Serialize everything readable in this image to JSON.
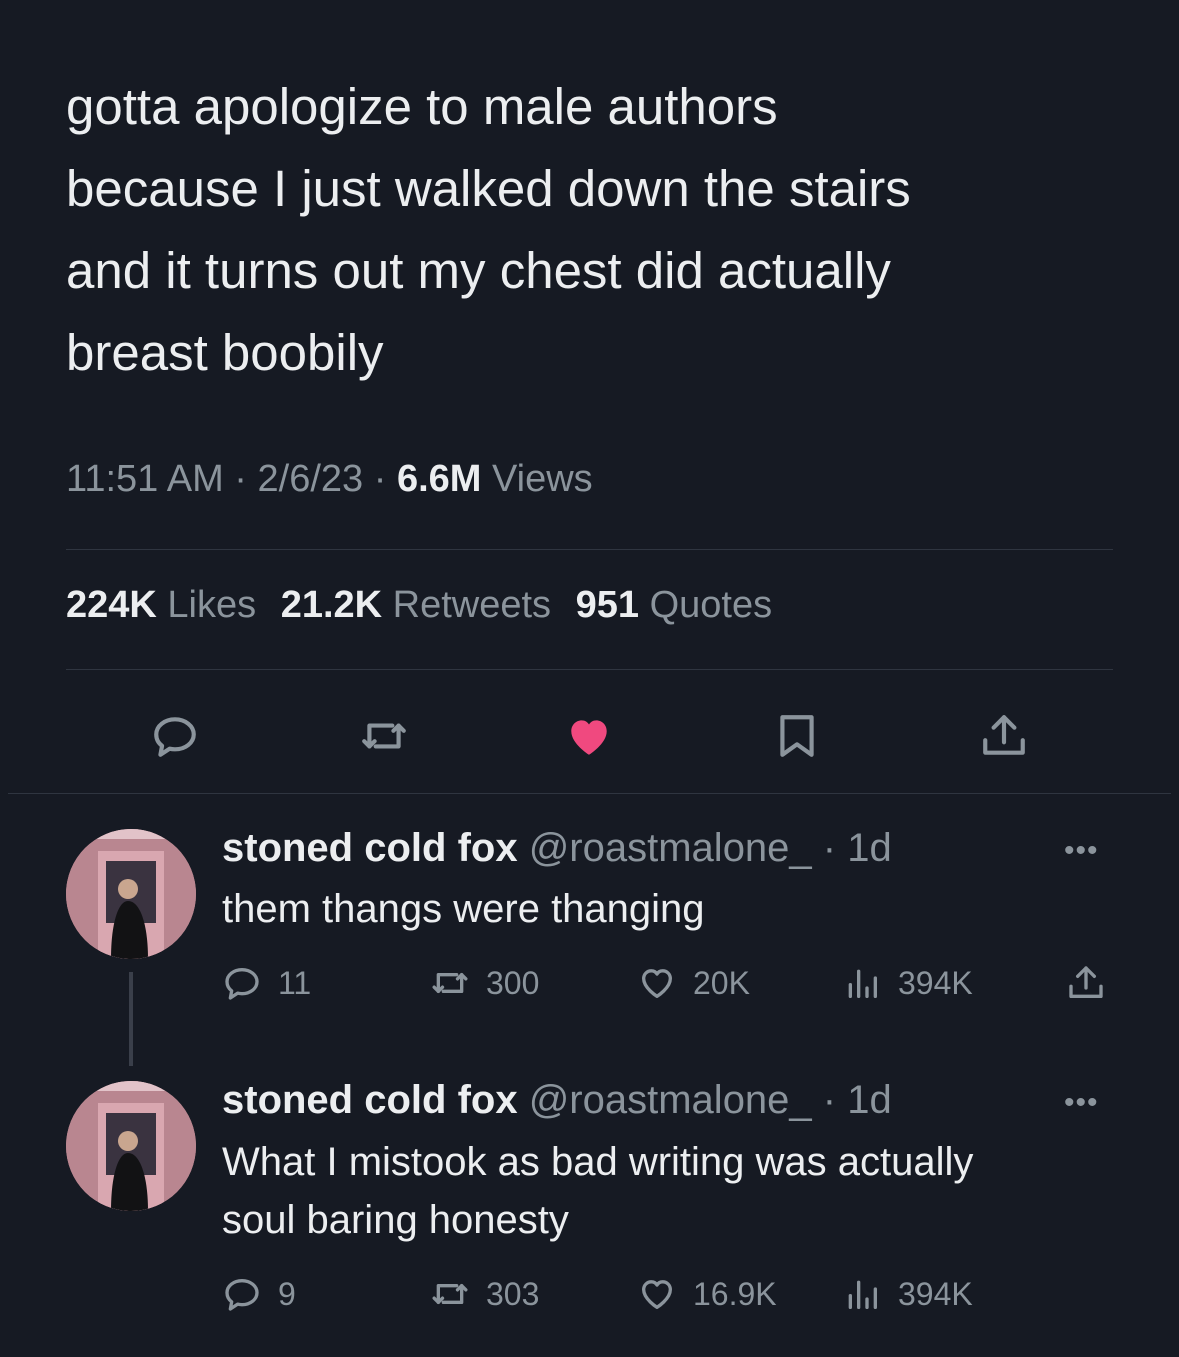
{
  "tweet": {
    "lines": [
      "gotta apologize to male authors",
      "because I just walked down the stairs",
      "and it turns out my chest did actually",
      "breast boobily"
    ],
    "time": "11:51 AM",
    "date": "2/6/23",
    "views_count": "6.6M",
    "views_label": "Views",
    "sep": "·"
  },
  "stats": {
    "likes_count": "224K",
    "likes_label": "Likes",
    "retweets_count": "21.2K",
    "retweets_label": "Retweets",
    "quotes_count": "951",
    "quotes_label": "Quotes"
  },
  "actions": {
    "icons": [
      "reply-icon",
      "retweet-icon",
      "like-icon",
      "bookmark-icon",
      "share-icon"
    ],
    "liked": true
  },
  "replies": [
    {
      "name": "stoned cold fox",
      "handle": "@roastmalone_",
      "age": "· 1d",
      "lines": [
        "them thangs were thanging"
      ],
      "replies": "11",
      "retweets": "300",
      "likes": "20K",
      "views": "394K"
    },
    {
      "name": "stoned cold fox",
      "handle": "@roastmalone_",
      "age": "· 1d",
      "lines": [
        "What I mistook as bad writing was actually",
        "soul baring honesty"
      ],
      "replies": "9",
      "retweets": "303",
      "likes": "16.9K",
      "views": "394K"
    }
  ],
  "more_label": "•••",
  "colors": {
    "background": "#161a23",
    "text": "#eceef0",
    "muted": "#8b949c",
    "like": "#f0497f"
  }
}
